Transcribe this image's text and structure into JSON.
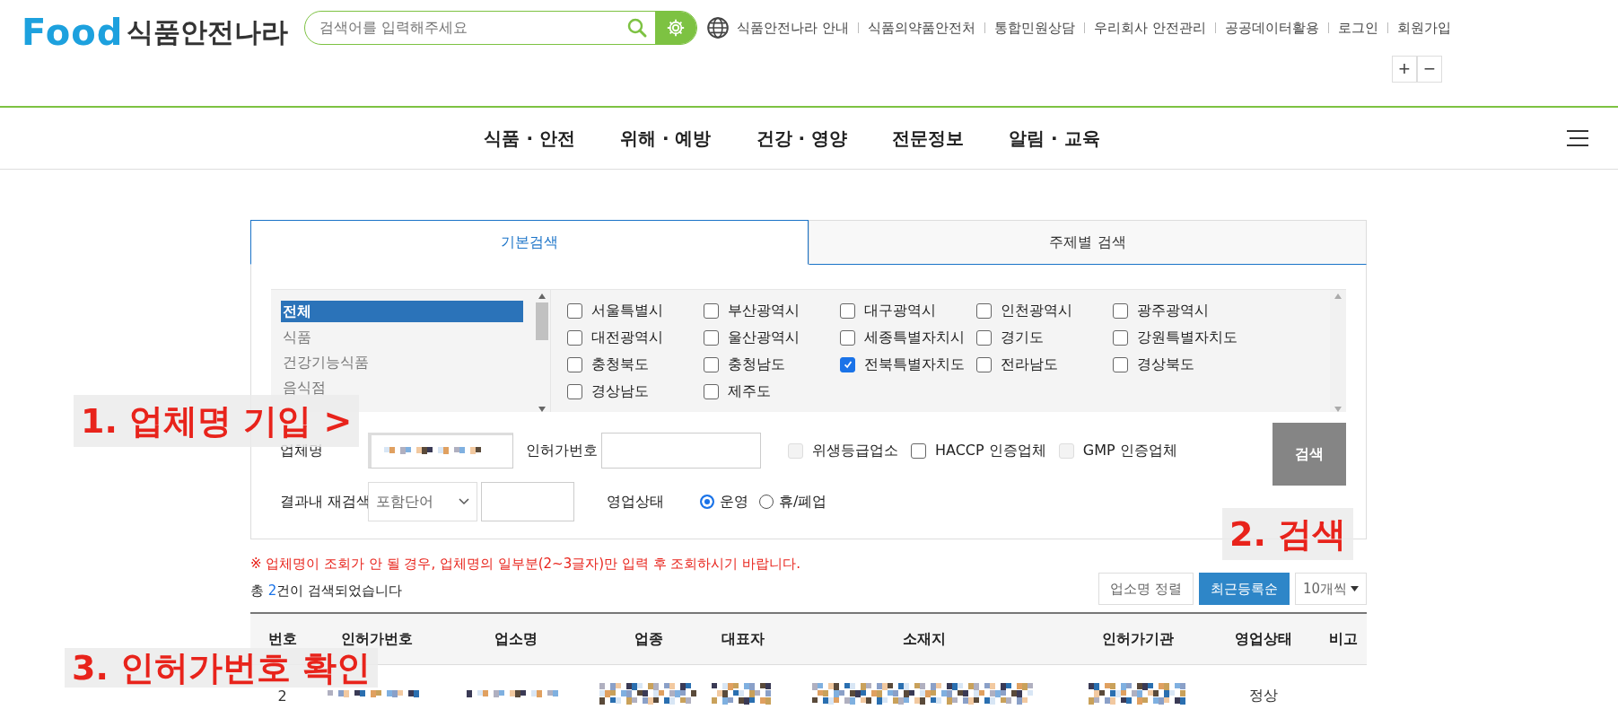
{
  "header": {
    "logo": {
      "word": "Food",
      "title": "식품안전나라"
    },
    "search": {
      "placeholder": "검색어를 입력해주세요"
    },
    "links": [
      "식품안전나라 안내",
      "식품의약품안전처",
      "통합민원상담",
      "우리회사 안전관리",
      "공공데이터활용",
      "로그인",
      "회원가입"
    ],
    "zoom_buttons": [
      "+",
      "−"
    ]
  },
  "nav": {
    "items": [
      "식품 · 안전",
      "위해 · 예방",
      "건강 · 영양",
      "전문정보",
      "알림 · 교육"
    ]
  },
  "tabs": [
    {
      "label": "기본검색",
      "selected": true
    },
    {
      "label": "주제별 검색",
      "selected": false
    }
  ],
  "categories": [
    {
      "label": "전체",
      "selected": true
    },
    {
      "label": "식품",
      "selected": false
    },
    {
      "label": "건강기능식품",
      "selected": false
    },
    {
      "label": "음식점",
      "selected": false
    }
  ],
  "regions": [
    {
      "label": "서울특별시",
      "checked": false
    },
    {
      "label": "부산광역시",
      "checked": false
    },
    {
      "label": "대구광역시",
      "checked": false
    },
    {
      "label": "인천광역시",
      "checked": false
    },
    {
      "label": "광주광역시",
      "checked": false
    },
    {
      "label": "대전광역시",
      "checked": false
    },
    {
      "label": "울산광역시",
      "checked": false
    },
    {
      "label": "세종특별자치시",
      "checked": false
    },
    {
      "label": "경기도",
      "checked": false
    },
    {
      "label": "강원특별자치도",
      "checked": false
    },
    {
      "label": "충청북도",
      "checked": false
    },
    {
      "label": "충청남도",
      "checked": false
    },
    {
      "label": "전북특별자치도",
      "checked": true
    },
    {
      "label": "전라남도",
      "checked": false
    },
    {
      "label": "경상북도",
      "checked": false
    },
    {
      "label": "경상남도",
      "checked": false
    },
    {
      "label": "제주도",
      "checked": false
    }
  ],
  "form": {
    "company_label": "업체명",
    "license_label": "인허가번호",
    "certs": [
      {
        "label": "위생등급업소",
        "checked": false,
        "disabled": true
      },
      {
        "label": "HACCP 인증업체",
        "checked": false,
        "disabled": false
      },
      {
        "label": "GMP 인증업체",
        "checked": false,
        "disabled": true
      }
    ],
    "search_button": "검색",
    "research_label": "결과내 재검색",
    "research_select": "포함단어",
    "status_label": "영업상태",
    "status_options": [
      {
        "label": "운영",
        "selected": true
      },
      {
        "label": "휴/폐업",
        "selected": false
      }
    ]
  },
  "notice": "※ 업체명이 조회가 안 될 경우, 업체명의 일부분(2~3글자)만 입력 후 조회하시기 바랍니다.",
  "result_count": {
    "prefix": "총 ",
    "count": "2",
    "suffix": "건이 검색되었습니다"
  },
  "sort_buttons": [
    {
      "label": "업소명 정렬",
      "selected": false
    },
    {
      "label": "최근등록순",
      "selected": true
    }
  ],
  "page_size": "10개씩",
  "table": {
    "columns": [
      "번호",
      "인허가번호",
      "업소명",
      "업종",
      "대표자",
      "소재지",
      "인허가기관",
      "영업상태",
      "비고"
    ],
    "rows": [
      [
        {
          "kind": "text",
          "text": "2"
        },
        {
          "kind": "redacted"
        },
        {
          "kind": "redacted"
        },
        {
          "kind": "redacted"
        },
        {
          "kind": "redacted"
        },
        {
          "kind": "redacted"
        },
        {
          "kind": "redacted"
        },
        {
          "kind": "text",
          "text": "정상"
        },
        {
          "kind": "empty"
        }
      ]
    ]
  },
  "annotations": [
    "1. 업체명 기입 >",
    "2. 검색",
    "3. 인허가번호 확인"
  ]
}
